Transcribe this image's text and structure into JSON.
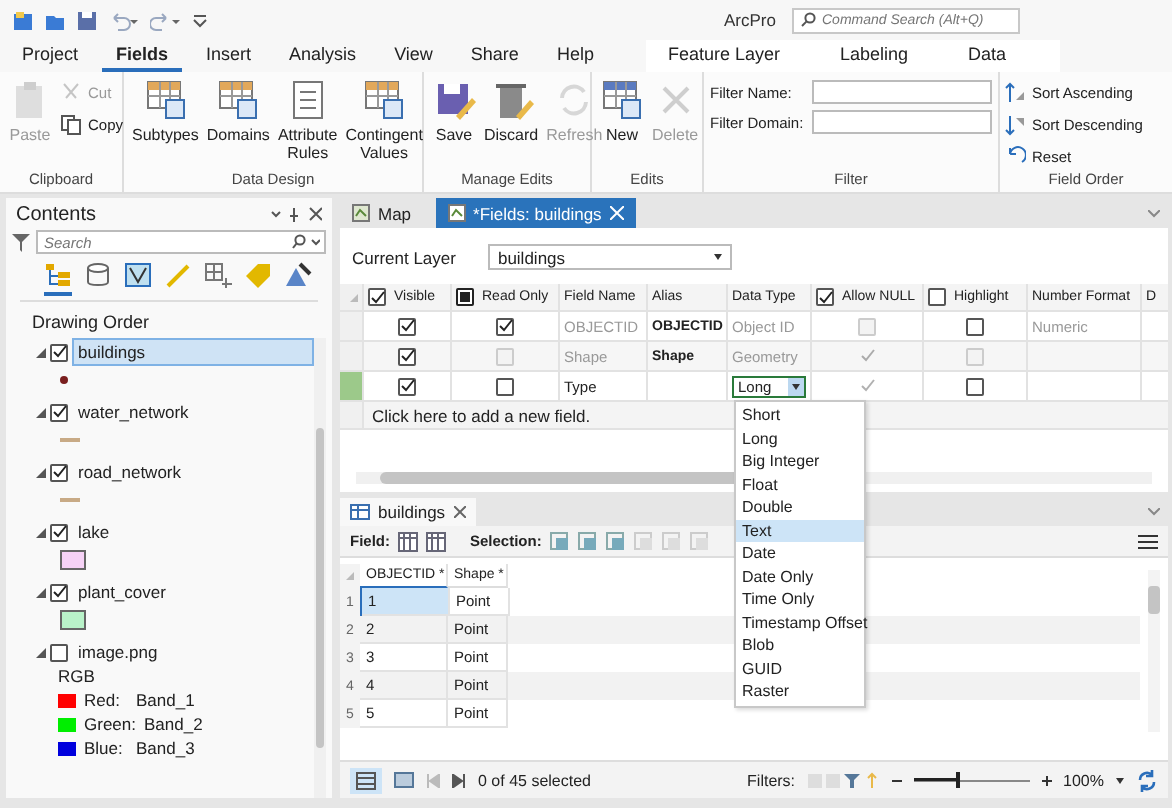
{
  "title_bar": {
    "app_name": "ArcPro",
    "search": {
      "placeholder": "Command Search (Alt+Q)"
    }
  },
  "ribbon_tabs": [
    {
      "label": "Project",
      "selected": false
    },
    {
      "label": "Fields",
      "selected": true
    },
    {
      "label": "Insert",
      "selected": false
    },
    {
      "label": "Analysis",
      "selected": false
    },
    {
      "label": "View",
      "selected": false
    },
    {
      "label": "Share",
      "selected": false
    },
    {
      "label": "Help",
      "selected": false
    }
  ],
  "contextual_tabs": [
    {
      "label": "Feature Layer",
      "selected": false
    },
    {
      "label": "Labeling",
      "selected": false
    },
    {
      "label": "Data",
      "selected": false
    }
  ],
  "ribbon_groups": [
    {
      "label": "Clipboard",
      "items": [
        {
          "kind": "large",
          "label": "Paste",
          "disabled": true
        },
        {
          "kind": "small",
          "label": "Cut",
          "disabled": true
        },
        {
          "kind": "small",
          "label": "Copy",
          "disabled": false
        }
      ]
    },
    {
      "label": "Data Design",
      "items": [
        {
          "kind": "large",
          "label": "Subtypes",
          "disabled": false
        },
        {
          "kind": "large",
          "label": "Domains",
          "disabled": false
        },
        {
          "kind": "large",
          "label": "Attribute Rules",
          "disabled": false
        },
        {
          "kind": "large",
          "label": "Contingent Values",
          "disabled": false
        }
      ]
    },
    {
      "label": "Manage Edits",
      "items": [
        {
          "kind": "large",
          "label": "Save",
          "disabled": false
        },
        {
          "kind": "large",
          "label": "Discard",
          "disabled": false
        },
        {
          "kind": "large",
          "label": "Refresh",
          "disabled": true
        }
      ]
    },
    {
      "label": "Edits",
      "items": [
        {
          "kind": "large",
          "label": "New",
          "disabled": false
        },
        {
          "kind": "large",
          "label": "Delete",
          "disabled": true
        }
      ]
    },
    {
      "label": "Filter",
      "items": [
        {
          "kind": "field",
          "label": "Filter Name:"
        },
        {
          "kind": "field",
          "label": "Filter Domain:"
        }
      ]
    },
    {
      "label": "Field Order",
      "items": [
        {
          "kind": "small",
          "label": "Sort Ascending",
          "disabled": false
        },
        {
          "kind": "small",
          "label": "Sort Descending",
          "disabled": false
        },
        {
          "kind": "small",
          "label": "Reset",
          "disabled": false
        }
      ]
    }
  ],
  "contents": {
    "title": "Contents",
    "search": {
      "placeholder": "Search"
    },
    "views": [
      {
        "selected": true
      },
      {
        "selected": false
      },
      {
        "selected": false
      },
      {
        "selected": false
      },
      {
        "selected": false
      },
      {
        "selected": false
      },
      {
        "selected": false
      }
    ],
    "heading": "Drawing Order",
    "layers": [
      {
        "name": "buildings",
        "checked": true,
        "selected": true,
        "symbol": {
          "kind": "point",
          "color": "#7a1f1f"
        }
      },
      {
        "name": "water_network",
        "checked": true,
        "selected": false,
        "symbol": {
          "kind": "line",
          "color": "#c8aa86"
        }
      },
      {
        "name": "road_network",
        "checked": true,
        "selected": false,
        "symbol": {
          "kind": "line",
          "color": "#c8aa86"
        }
      },
      {
        "name": "lake",
        "checked": true,
        "selected": false,
        "symbol": {
          "kind": "fill",
          "color": "#f6d2f6"
        }
      },
      {
        "name": "plant_cover",
        "checked": true,
        "selected": false,
        "symbol": {
          "kind": "fill",
          "color": "#b9f3c9"
        }
      },
      {
        "name": "image.png",
        "checked": false,
        "selected": false,
        "legend": {
          "title": "RGB",
          "bands": [
            {
              "name": "Red:",
              "value": "Band_1",
              "color": "#ff0000"
            },
            {
              "name": "Green:",
              "value": "Band_2",
              "color": "#00ee00"
            },
            {
              "name": "Blue:",
              "value": "Band_3",
              "color": "#0000dd"
            }
          ]
        }
      }
    ]
  },
  "document_tabs": [
    {
      "label": "Map",
      "selected": false,
      "closable": false
    },
    {
      "label": "*Fields: buildings",
      "selected": true,
      "closable": true
    }
  ],
  "fields_view": {
    "current_layer": {
      "label": "Current Layer",
      "value": "buildings"
    },
    "columns": [
      {
        "label": "Visible",
        "header_checkbox": {
          "checked": true
        }
      },
      {
        "label": "Read Only",
        "header_checkbox": {
          "mixed": true
        }
      },
      {
        "label": "Field Name"
      },
      {
        "label": "Alias"
      },
      {
        "label": "Data Type"
      },
      {
        "label": "Allow NULL",
        "header_checkbox": {
          "checked": true
        }
      },
      {
        "label": "Highlight",
        "header_checkbox": {
          "checked": false
        }
      },
      {
        "label": "Number Format"
      },
      {
        "label": "D"
      }
    ],
    "rows": [
      {
        "selected": false,
        "locked": true,
        "visible": {
          "checked": true,
          "disabled": false
        },
        "read_only": {
          "checked": true,
          "disabled": false
        },
        "field_name": "OBJECTID",
        "alias": "OBJECTID",
        "data_type": {
          "value": "Object ID",
          "open": false
        },
        "allow_null": {
          "checked": false,
          "disabled": true
        },
        "highlight": {
          "checked": false,
          "disabled": false
        },
        "number_format": "Numeric"
      },
      {
        "selected": false,
        "locked": true,
        "visible": {
          "checked": true,
          "disabled": false
        },
        "read_only": {
          "checked": false,
          "disabled": true
        },
        "field_name": "Shape",
        "alias": "Shape",
        "data_type": {
          "value": "Geometry",
          "open": false
        },
        "allow_null": {
          "checked": true,
          "disabled": true
        },
        "highlight": {
          "checked": false,
          "disabled": true
        }
      },
      {
        "selected": true,
        "locked": false,
        "visible": {
          "checked": true,
          "disabled": false
        },
        "read_only": {
          "checked": false,
          "disabled": false
        },
        "field_name": "Type",
        "data_type": {
          "value": "Long",
          "open": true
        },
        "allow_null": {
          "checked": true,
          "disabled": true
        },
        "highlight": {
          "checked": false,
          "disabled": false
        }
      }
    ],
    "add_row": "Click here to add a new field.",
    "data_type_options": [
      {
        "label": "Short",
        "selected": false
      },
      {
        "label": "Long",
        "selected": false
      },
      {
        "label": "Big Integer",
        "selected": false
      },
      {
        "label": "Float",
        "selected": false
      },
      {
        "label": "Double",
        "selected": false
      },
      {
        "label": "Text",
        "selected": true
      },
      {
        "label": "Date",
        "selected": false
      },
      {
        "label": "Date Only",
        "selected": false
      },
      {
        "label": "Time Only",
        "selected": false
      },
      {
        "label": "Timestamp Offset",
        "selected": false
      },
      {
        "label": "Blob",
        "selected": false
      },
      {
        "label": "GUID",
        "selected": false
      },
      {
        "label": "Raster",
        "selected": false
      }
    ]
  },
  "attribute_table": {
    "tab": {
      "label": "buildings",
      "selected": true
    },
    "field_label": "Field:",
    "selection_label": "Selection:",
    "columns": [
      "OBJECTID *",
      "Shape *"
    ],
    "rows": [
      {
        "number": "1",
        "cells": [
          "1",
          "Point"
        ],
        "selected": true
      },
      {
        "number": "2",
        "cells": [
          "2",
          "Point"
        ],
        "selected": false
      },
      {
        "number": "3",
        "cells": [
          "3",
          "Point"
        ],
        "selected": false
      },
      {
        "number": "4",
        "cells": [
          "4",
          "Point"
        ],
        "selected": false
      },
      {
        "number": "5",
        "cells": [
          "5",
          "Point"
        ],
        "selected": false
      }
    ],
    "status": {
      "record_count": "0 of 45 selected",
      "filters_label": "Filters:",
      "zoom": {
        "level": 0.4
      },
      "zoom_value": "100%"
    }
  }
}
